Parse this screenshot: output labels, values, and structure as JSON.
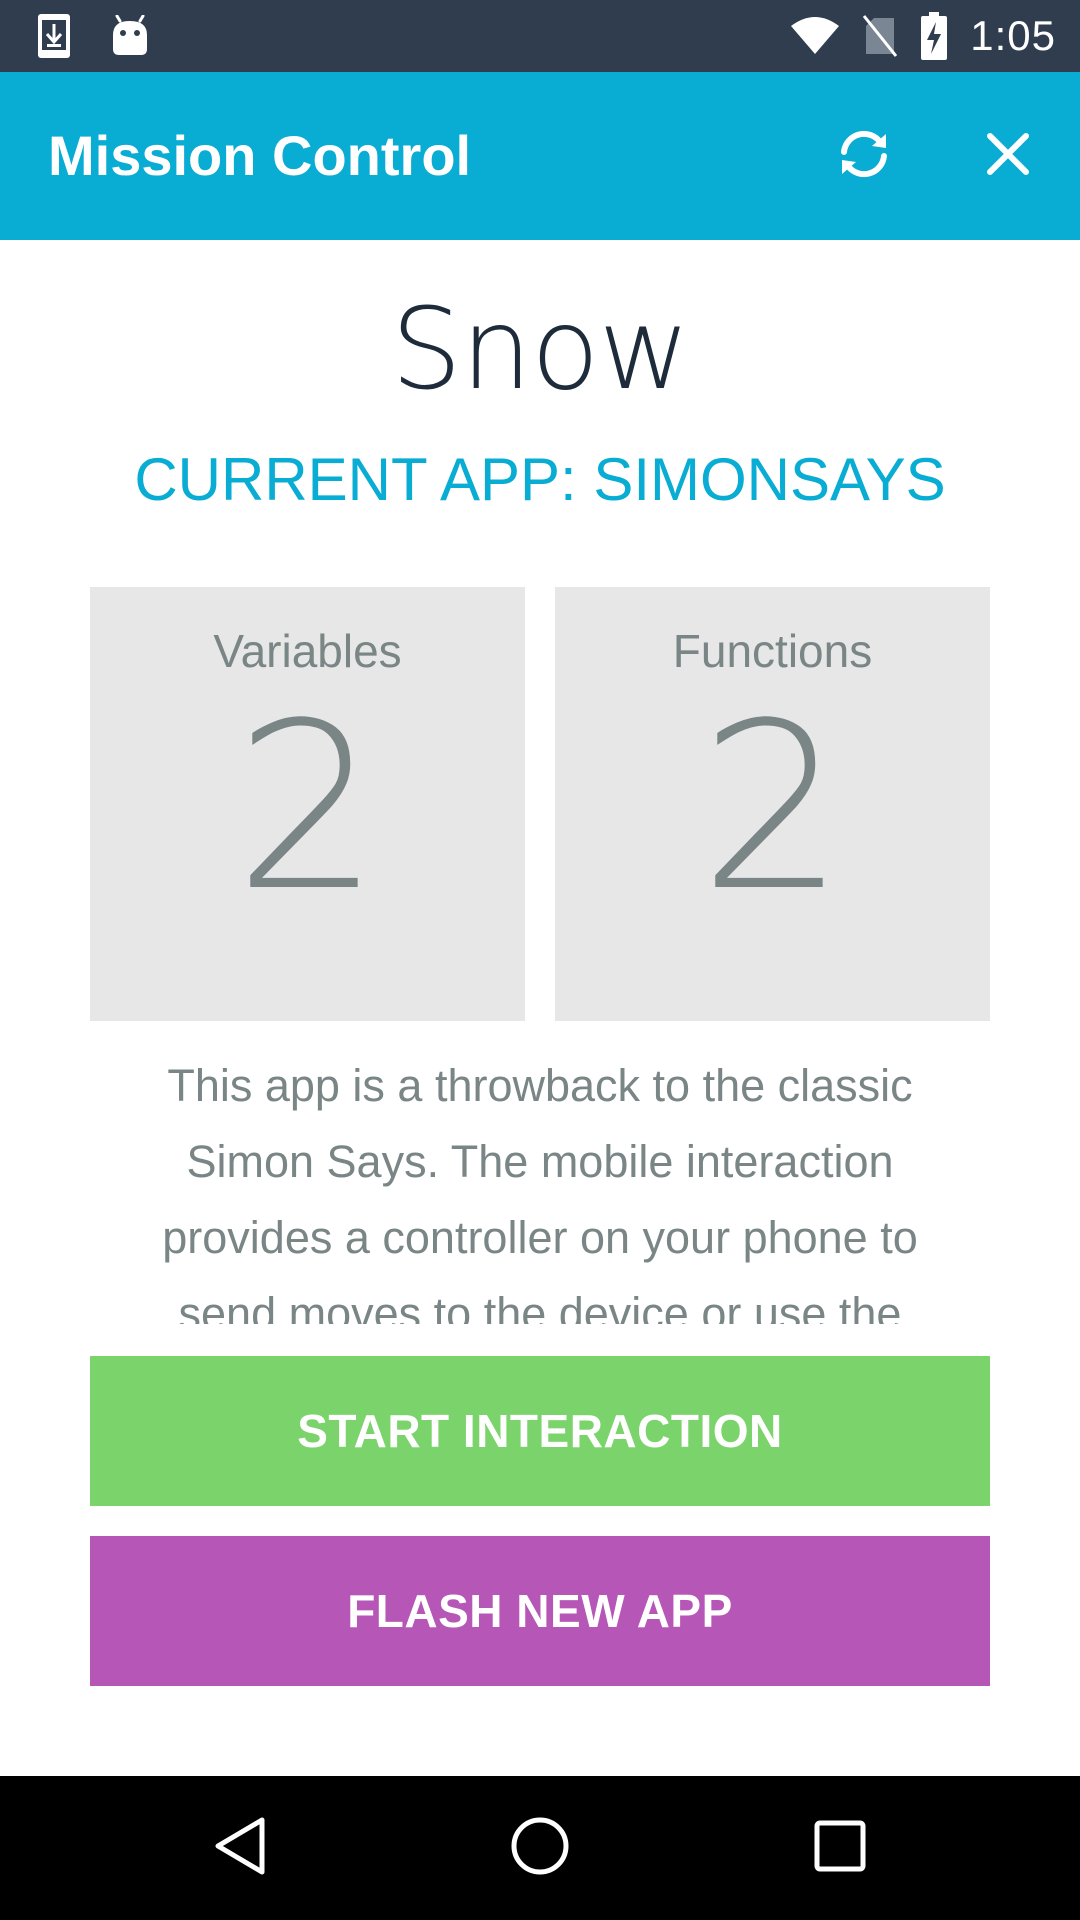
{
  "status_bar": {
    "time": "1:05",
    "icons": [
      "download-icon",
      "android-icon",
      "wifi-icon",
      "no-sim-icon",
      "battery-charging-icon"
    ]
  },
  "app_bar": {
    "title": "Mission Control",
    "actions": [
      "refresh-icon",
      "close-icon"
    ],
    "background_color": "#09acd3"
  },
  "device": {
    "name": "Snow"
  },
  "current_app_label": "CURRENT APP: SIMONSAYS",
  "stats": [
    {
      "label": "Variables",
      "value": "2"
    },
    {
      "label": "Functions",
      "value": "2"
    }
  ],
  "description": "This app is a throwback to the classic Simon Says. The mobile interaction provides a controller on your phone to send moves to the device or use the",
  "buttons": {
    "start": {
      "label": "START INTERACTION",
      "color": "#7bd36b"
    },
    "flash": {
      "label": "FLASH NEW APP",
      "color": "#b656b6"
    }
  },
  "nav_bar": {
    "icons": [
      "back-icon",
      "home-icon",
      "recents-icon"
    ]
  }
}
